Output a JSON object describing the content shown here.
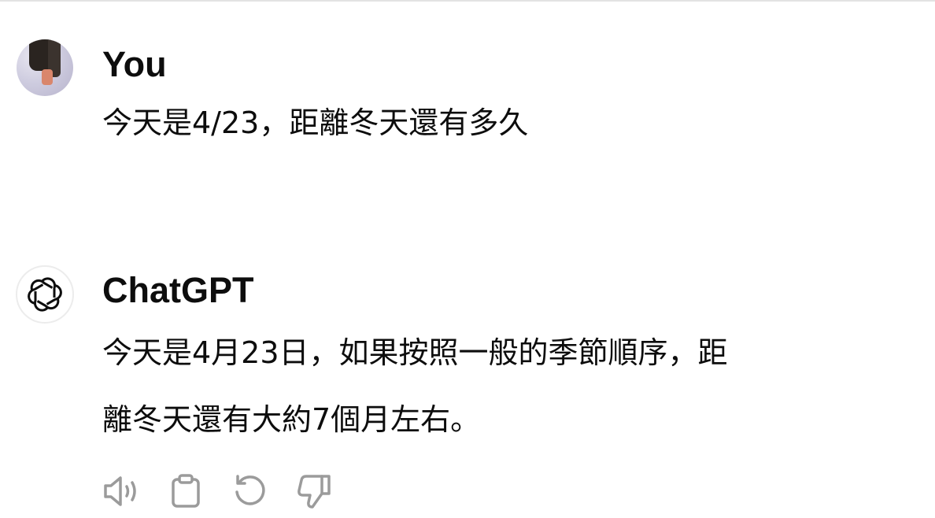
{
  "conversation": {
    "user": {
      "author": "You",
      "message": "今天是4/23，距離冬天還有多久"
    },
    "assistant": {
      "author": "ChatGPT",
      "message_line1": "今天是4月23日，如果按照一般的季節順序，距",
      "message_line2": "離冬天還有大約7個月左右。"
    }
  },
  "actions": [
    {
      "icon": "speaker-icon"
    },
    {
      "icon": "clipboard-icon"
    },
    {
      "icon": "regenerate-icon"
    },
    {
      "icon": "thumbs-down-icon"
    }
  ],
  "colors": {
    "text": "#0d0d0d",
    "icon": "#9b9b9b",
    "divider": "#e3e3e3"
  }
}
